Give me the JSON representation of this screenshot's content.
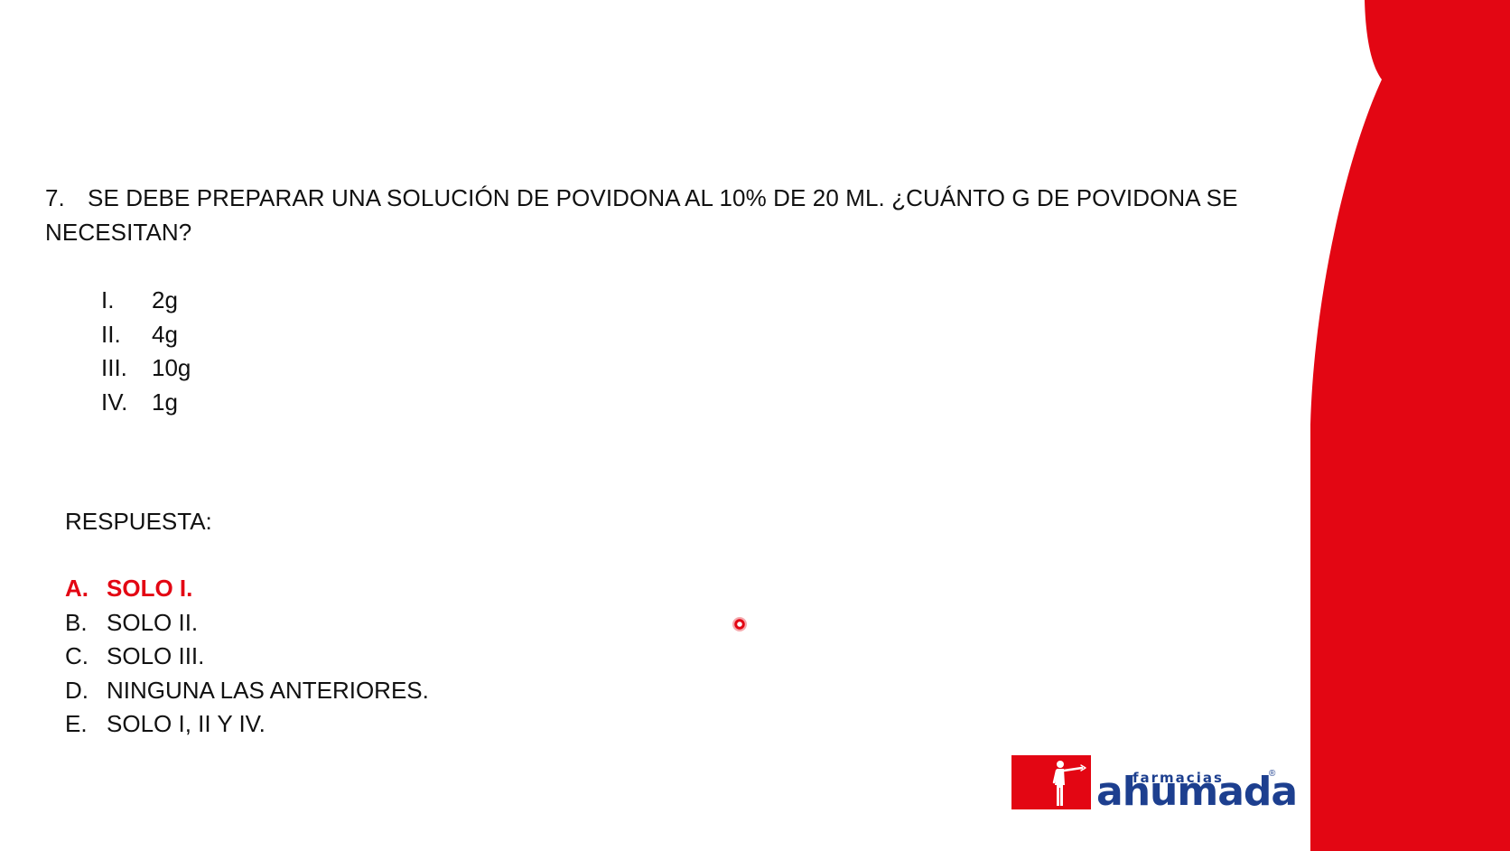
{
  "question": {
    "number": "7.",
    "text": "SE DEBE PREPARAR UNA SOLUCIÓN DE POVIDONA AL 10% DE 20 ML. ¿CUÁNTO G DE POVIDONA SE NECESITAN?"
  },
  "options": [
    {
      "numeral": "I.",
      "value": "2g"
    },
    {
      "numeral": "II.",
      "value": "4g"
    },
    {
      "numeral": "III.",
      "value": "10g"
    },
    {
      "numeral": "IV.",
      "value": "1g"
    }
  ],
  "answer_label": "RESPUESTA:",
  "answers": [
    {
      "letter": "A.",
      "text": "SOLO I.",
      "highlighted": true
    },
    {
      "letter": "B.",
      "text": "SOLO II.",
      "highlighted": false
    },
    {
      "letter": "C.",
      "text": "SOLO III.",
      "highlighted": false
    },
    {
      "letter": "D.",
      "text": "NINGUNA LAS ANTERIORES.",
      "highlighted": false
    },
    {
      "letter": "E.",
      "text": "SOLO I, II Y IV.",
      "highlighted": false
    }
  ],
  "logo": {
    "small_text": "farmacias",
    "big_text": "ahumada",
    "registered": "®"
  },
  "colors": {
    "accent_red": "#e30613",
    "logo_blue": "#1d3f8f",
    "text": "#111111",
    "background": "#ffffff"
  },
  "icons": {
    "pointer": "laser-pointer-icon",
    "logo_figure": "pointing-man-icon"
  }
}
